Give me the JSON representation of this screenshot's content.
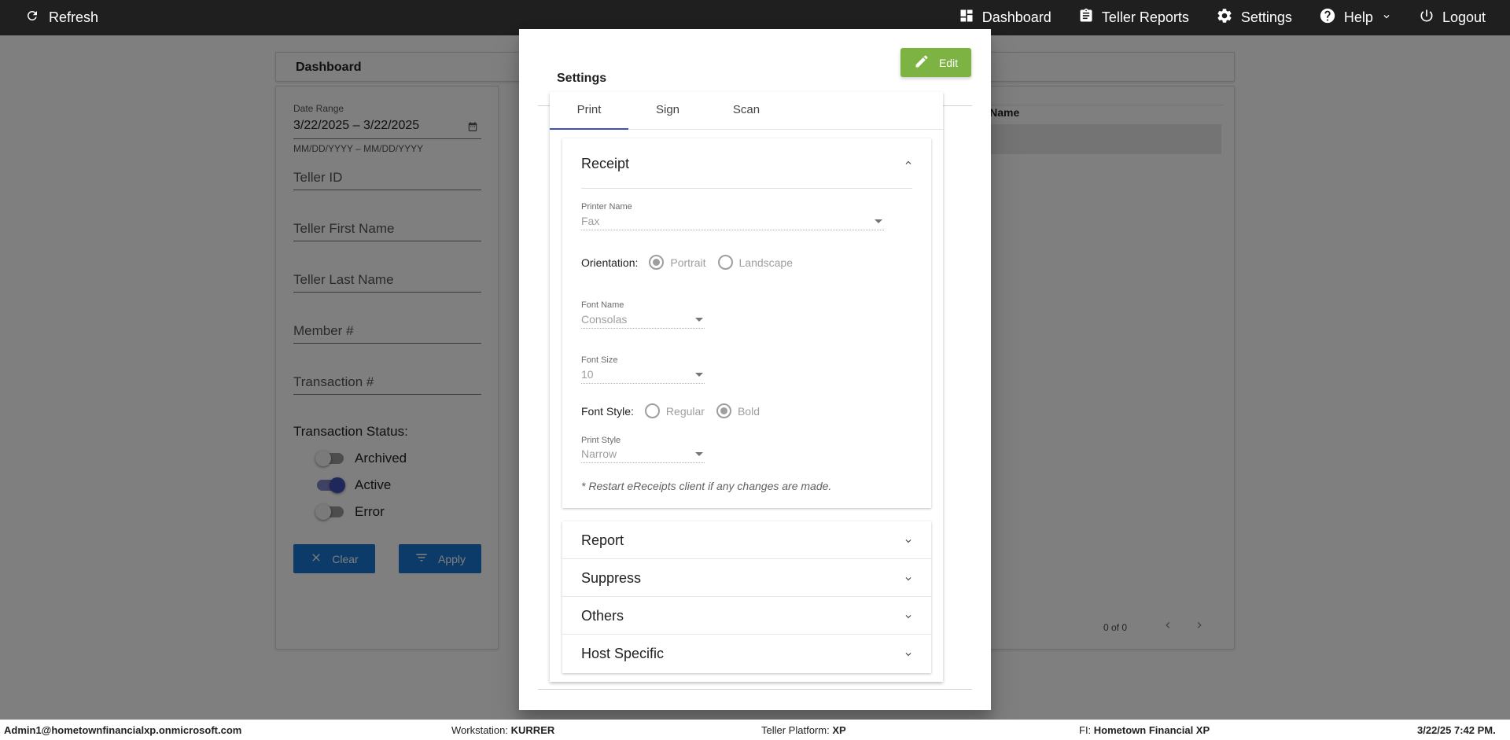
{
  "topbar": {
    "refresh_label": "Refresh",
    "nav": [
      {
        "label": "Dashboard",
        "icon": "dashboard-icon"
      },
      {
        "label": "Teller Reports",
        "icon": "clipboard-icon"
      },
      {
        "label": "Settings",
        "icon": "gear-icon"
      },
      {
        "label": "Help",
        "icon": "help-circle-icon"
      },
      {
        "label": "Logout",
        "icon": "power-icon"
      }
    ]
  },
  "dashboard": {
    "title": "Dashboard",
    "filters": {
      "date_range_label": "Date Range",
      "date_range_value": "3/22/2025 – 3/22/2025",
      "date_hint": "MM/DD/YYYY – MM/DD/YYYY",
      "teller_id": "Teller ID",
      "teller_first_name": "Teller First Name",
      "teller_last_name": "Teller Last Name",
      "member": "Member #",
      "transaction": "Transaction #",
      "status_title": "Transaction Status:",
      "statuses": [
        {
          "label": "Archived",
          "on": false
        },
        {
          "label": "Active",
          "on": true
        },
        {
          "label": "Error",
          "on": false
        }
      ],
      "clear_label": "Clear",
      "apply_label": "Apply"
    },
    "list": {
      "column_partial": "er Name",
      "pager_text": "0 of 0"
    }
  },
  "modal": {
    "title": "Settings",
    "edit_label": "Edit",
    "tabs": [
      "Print",
      "Sign",
      "Scan"
    ],
    "active_tab": "Print",
    "receipt": {
      "title": "Receipt",
      "printer_name_label": "Printer Name",
      "printer_name_value": "Fax",
      "orientation_label": "Orientation:",
      "orientation_options": [
        "Portrait",
        "Landscape"
      ],
      "orientation_selected": "Portrait",
      "font_name_label": "Font Name",
      "font_name_value": "Consolas",
      "font_size_label": "Font Size",
      "font_size_value": "10",
      "font_style_label": "Font Style:",
      "font_style_options": [
        "Regular",
        "Bold"
      ],
      "font_style_selected": "Bold",
      "print_style_label": "Print Style",
      "print_style_value": "Narrow",
      "note": "* Restart eReceipts client if any changes are made."
    },
    "sections": [
      "Report",
      "Suppress",
      "Others",
      "Host Specific"
    ]
  },
  "statusbar": {
    "user": "Admin1@hometownfinancialxp.onmicrosoft.com",
    "workstation_label": "Workstation:",
    "workstation_value": "KURRER",
    "platform_label": "Teller Platform:",
    "platform_value": "XP",
    "fi_label": "FI:",
    "fi_value": "Hometown Financial XP",
    "datetime": "3/22/25 7:42 PM."
  },
  "colors": {
    "topbar": "#1f1f1f",
    "accent_blue": "#1976d2",
    "edit_green": "#7cb342",
    "tab_indicator": "#3f51b5"
  }
}
